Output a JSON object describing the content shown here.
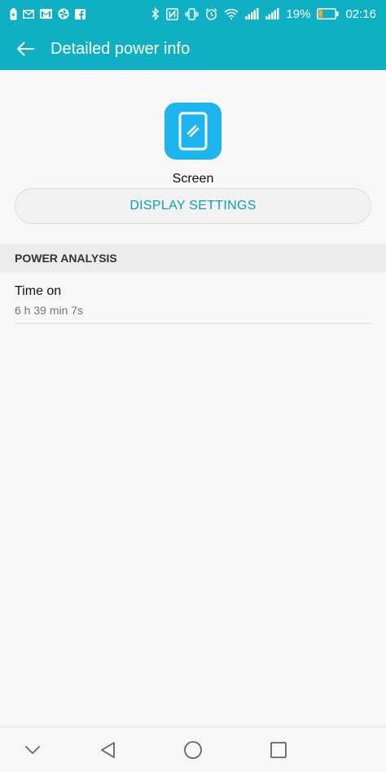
{
  "status_bar": {
    "left_icons": [
      "battery-saver-icon",
      "mail-icon",
      "gmail-icon",
      "pinwheel-icon",
      "facebook-icon"
    ],
    "right_icons": [
      "bluetooth-icon",
      "nfc-icon",
      "vibrate-icon",
      "alarm-icon",
      "wifi-icon",
      "signal-icon",
      "signal-icon"
    ],
    "battery_percent": "19%",
    "time": "02:16"
  },
  "app_bar": {
    "title": "Detailed power info"
  },
  "app_info": {
    "name": "Screen",
    "icon": "screen-phone-icon"
  },
  "actions": {
    "display_settings_label": "DISPLAY SETTINGS"
  },
  "power_analysis": {
    "header": "POWER ANALYSIS",
    "items": [
      {
        "title": "Time on",
        "value": "6 h 39 min 7s"
      }
    ]
  },
  "nav_bar": {
    "icons": [
      "collapse-chevron-icon",
      "back-triangle-icon",
      "home-circle-icon",
      "recents-square-icon"
    ]
  },
  "colors": {
    "accent": "#0fb0c4",
    "icon_blue": "#1cb5f0",
    "button_text": "#0aa0b6"
  }
}
